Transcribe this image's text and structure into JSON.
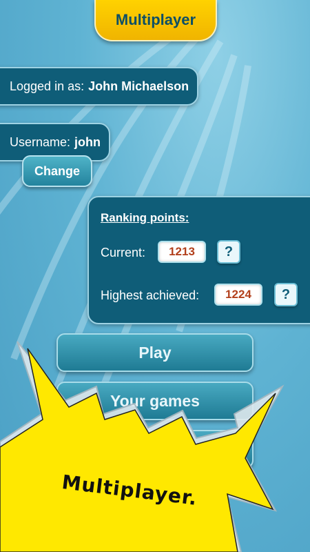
{
  "header": {
    "title": "Multiplayer"
  },
  "account": {
    "logged_in_label": "Logged in as:",
    "logged_in_name": "John Michaelson",
    "username_label": "Username:",
    "username_value": "john",
    "change_label": "Change"
  },
  "ranking": {
    "title": "Ranking points:",
    "current_label": "Current:",
    "current_value": "1213",
    "highest_label": "Highest achieved:",
    "highest_value": "1224",
    "help_glyph": "?"
  },
  "menu": {
    "play_label": "Play",
    "your_games_label": "Your games"
  },
  "promo": {
    "caption": "Multiplayer."
  },
  "colors": {
    "accent": "#ffd200",
    "panel": "#0f5d78",
    "value_text": "#b2401c"
  },
  "icons": {
    "help": "question-mark-icon"
  }
}
